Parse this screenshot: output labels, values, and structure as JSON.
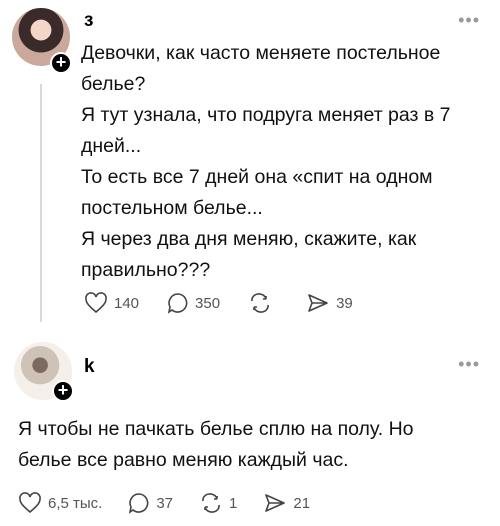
{
  "posts": [
    {
      "username": "з",
      "more": "•••",
      "lines": [
        "Девочки, как часто меняете постельное",
        "белье?",
        "Я тут узнала, что подруга меняет раз в 7",
        "дней...",
        "То есть все 7 дней она «спит на одном",
        "постельном белье...",
        "Я через два дня меняю, скажите, как",
        "правильно???"
      ],
      "likes": "140",
      "comments": "350",
      "reposts": "",
      "shares": "39"
    },
    {
      "username": "k",
      "more": "•••",
      "lines": [
        "Я чтобы не пачкать белье сплю на полу. Но",
        "белье все равно меняю каждый час."
      ],
      "likes": "6,5 тыс.",
      "comments": "37",
      "reposts": "1",
      "shares": "21"
    }
  ]
}
